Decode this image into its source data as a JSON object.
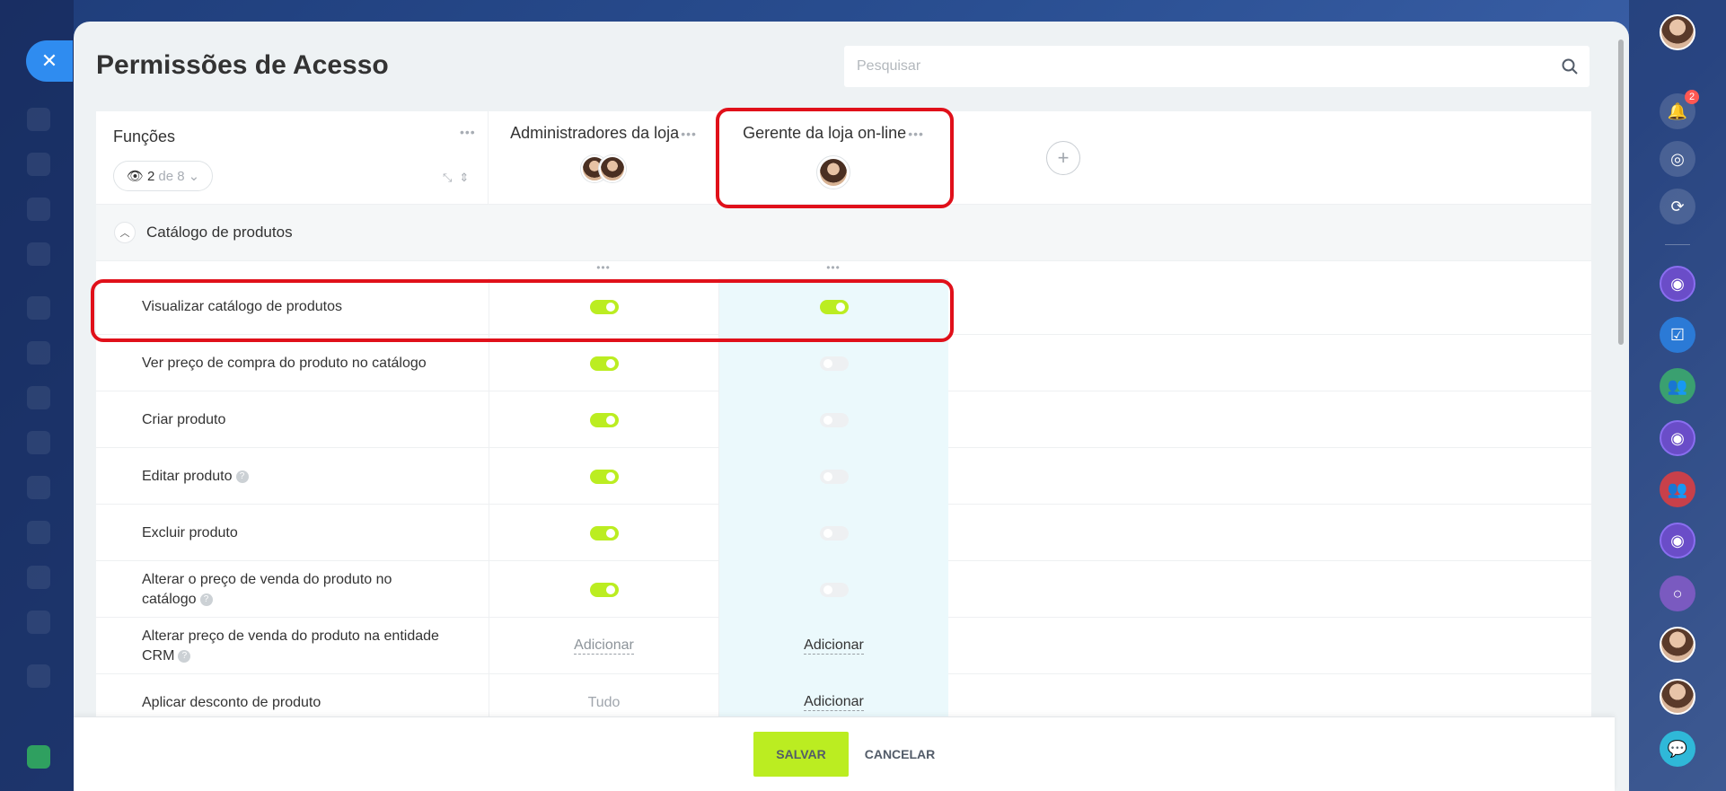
{
  "page": {
    "title": "Permissões de Acesso",
    "search_placeholder": "Pesquisar"
  },
  "roles_header": {
    "label": "Funções",
    "view_count": "2",
    "view_of": "de 8"
  },
  "roles": [
    {
      "name": "Administradores da loja"
    },
    {
      "name": "Gerente da loja on-line"
    }
  ],
  "section": {
    "title": "Catálogo de produtos"
  },
  "rows": [
    {
      "name": "Visualizar catálogo de produtos",
      "help": false,
      "admin": "on",
      "manager": "on"
    },
    {
      "name": "Ver preço de compra do produto no catálogo",
      "help": false,
      "admin": "on",
      "manager": "off"
    },
    {
      "name": "Criar produto",
      "help": false,
      "admin": "on",
      "manager": "off"
    },
    {
      "name": "Editar produto",
      "help": true,
      "admin": "on",
      "manager": "off"
    },
    {
      "name": "Excluir produto",
      "help": false,
      "admin": "on",
      "manager": "off"
    },
    {
      "name": "Alterar o preço de venda do produto no catálogo",
      "help": true,
      "admin": "on",
      "manager": "off"
    },
    {
      "name": "Alterar preço de venda do produto na entidade CRM",
      "help": true,
      "admin_text": "Adicionar",
      "manager_text": "Adicionar"
    },
    {
      "name": "Aplicar desconto de produto",
      "help": false,
      "admin_text": "Tudo",
      "manager_text": "Adicionar"
    }
  ],
  "footer": {
    "save": "SALVAR",
    "cancel": "CANCELAR"
  },
  "notifications": {
    "count": "2"
  },
  "colors": {
    "accent": "#bbed21",
    "highlight": "#e0101a",
    "column_bg": "#ebf9fc",
    "close": "#2f8cf0"
  }
}
